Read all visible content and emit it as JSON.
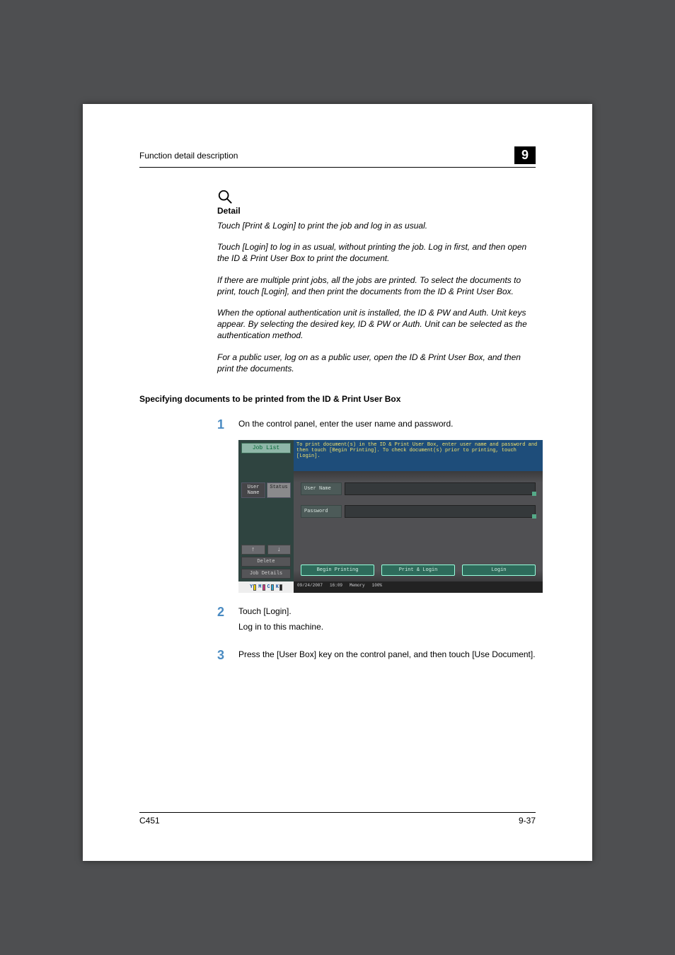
{
  "header": {
    "title": "Function detail description",
    "chapter": "9"
  },
  "detail": {
    "heading": "Detail",
    "paragraphs": [
      "Touch [Print & Login] to print the job and log in as usual.",
      "Touch [Login] to log in as usual, without printing the job. Log in first, and then open the ID & Print User Box to print the document.",
      "If there are multiple print jobs, all the jobs are printed. To select the documents to print, touch [Login], and then print the documents from the ID & Print User Box.",
      "When the optional authentication unit is installed, the ID & PW and Auth. Unit keys appear. By selecting the desired key, ID & PW or Auth. Unit can be selected as the authentication method.",
      "For a public user, log on as a public user, open the ID & Print User Box, and then print the documents."
    ]
  },
  "section_heading": "Specifying documents to be printed from the ID & Print User Box",
  "steps": [
    {
      "num": "1",
      "lines": [
        "On the control panel, enter the user name and password."
      ]
    },
    {
      "num": "2",
      "lines": [
        "Touch [Login].",
        "Log in to this machine."
      ]
    },
    {
      "num": "3",
      "lines": [
        "Press the [User Box] key on the control panel, and then touch [Use Document]."
      ]
    }
  ],
  "screenshot": {
    "job_list": "Job List",
    "message": "To print document(s) in the ID & Print User Box, enter user name and password and then touch [Begin Printing]. To check document(s) prior to printing, touch [Login].",
    "tabs": {
      "left": "User Name",
      "right": "Status"
    },
    "arrows": {
      "up": "↑",
      "down": "↓"
    },
    "left_buttons": {
      "delete": "Delete",
      "details": "Job Details"
    },
    "fields": {
      "username": "User Name",
      "password": "Password"
    },
    "actions": {
      "begin": "Begin Printing",
      "printlogin": "Print & Login",
      "login": "Login"
    },
    "toner": {
      "y": "Y",
      "m": "M",
      "c": "C",
      "k": "K"
    },
    "status": {
      "date": "09/24/2007",
      "time": "16:09",
      "mem_label": "Memory",
      "mem_val": "100%"
    }
  },
  "footer": {
    "left": "C451",
    "right": "9-37"
  }
}
